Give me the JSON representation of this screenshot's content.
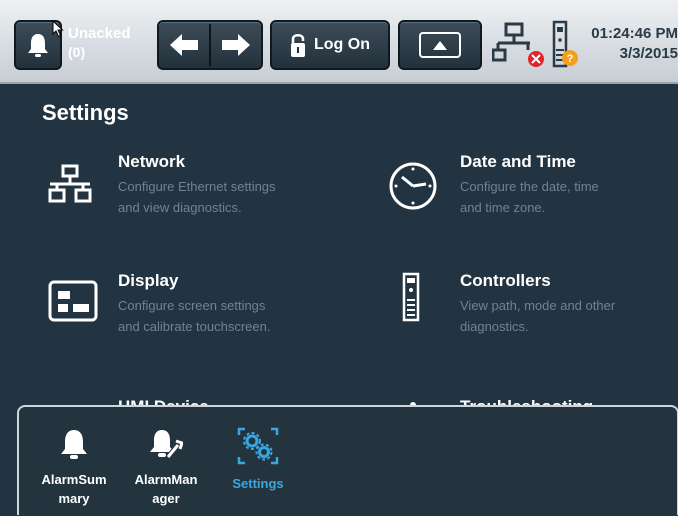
{
  "topbar": {
    "unacked_label": "Unacked",
    "unacked_count": "(0)",
    "logon_label": "Log On",
    "time": "01:24:46 PM",
    "date": "3/3/2015"
  },
  "settings": {
    "title": "Settings",
    "items": [
      {
        "title": "Network",
        "desc_line1": "Configure Ethernet settings",
        "desc_line2": "and view diagnostics.",
        "icon": "network-icon"
      },
      {
        "title": "Date and Time",
        "desc_line1": "Configure the date, time",
        "desc_line2": "and time zone.",
        "icon": "clock-icon"
      },
      {
        "title": "Display",
        "desc_line1": "Configure screen settings",
        "desc_line2": "and calibrate touchscreen.",
        "icon": "display-icon"
      },
      {
        "title": "Controllers",
        "desc_line1": "View path, mode and other",
        "desc_line2": "diagnostics.",
        "icon": "controller-icon"
      },
      {
        "title": "HMI Device",
        "icon": "hmi-device-icon"
      },
      {
        "title": "Troubleshooting",
        "icon": "troubleshooting-icon"
      }
    ]
  },
  "drawer": {
    "items": [
      {
        "label_line1": "AlarmSum",
        "label_line2": "mary",
        "icon": "alarm-bell-icon"
      },
      {
        "label_line1": "AlarmMan",
        "label_line2": "ager",
        "icon": "alarm-manager-icon"
      },
      {
        "label_line1": "Settings",
        "label_line2": "",
        "icon": "settings-gears-icon"
      }
    ]
  },
  "colors": {
    "background": "#223441",
    "accent": "#39a8e0",
    "description_text": "#6f8392",
    "error": "#e0262a",
    "warning": "#f4a01c"
  }
}
